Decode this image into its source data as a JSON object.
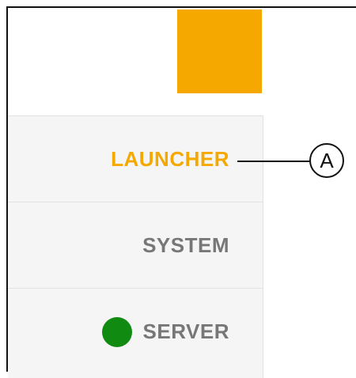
{
  "colors": {
    "accent": "#f5a800",
    "menu_text": "#777777",
    "status_green": "#118a11",
    "menu_background": "#f5f5f5"
  },
  "menu": {
    "items": [
      {
        "label": "LAUNCHER",
        "state": "active"
      },
      {
        "label": "SYSTEM",
        "state": "normal"
      },
      {
        "label": "SERVER",
        "state": "normal",
        "status_icon": "green-status-dot"
      }
    ]
  },
  "callout": {
    "label": "A"
  }
}
